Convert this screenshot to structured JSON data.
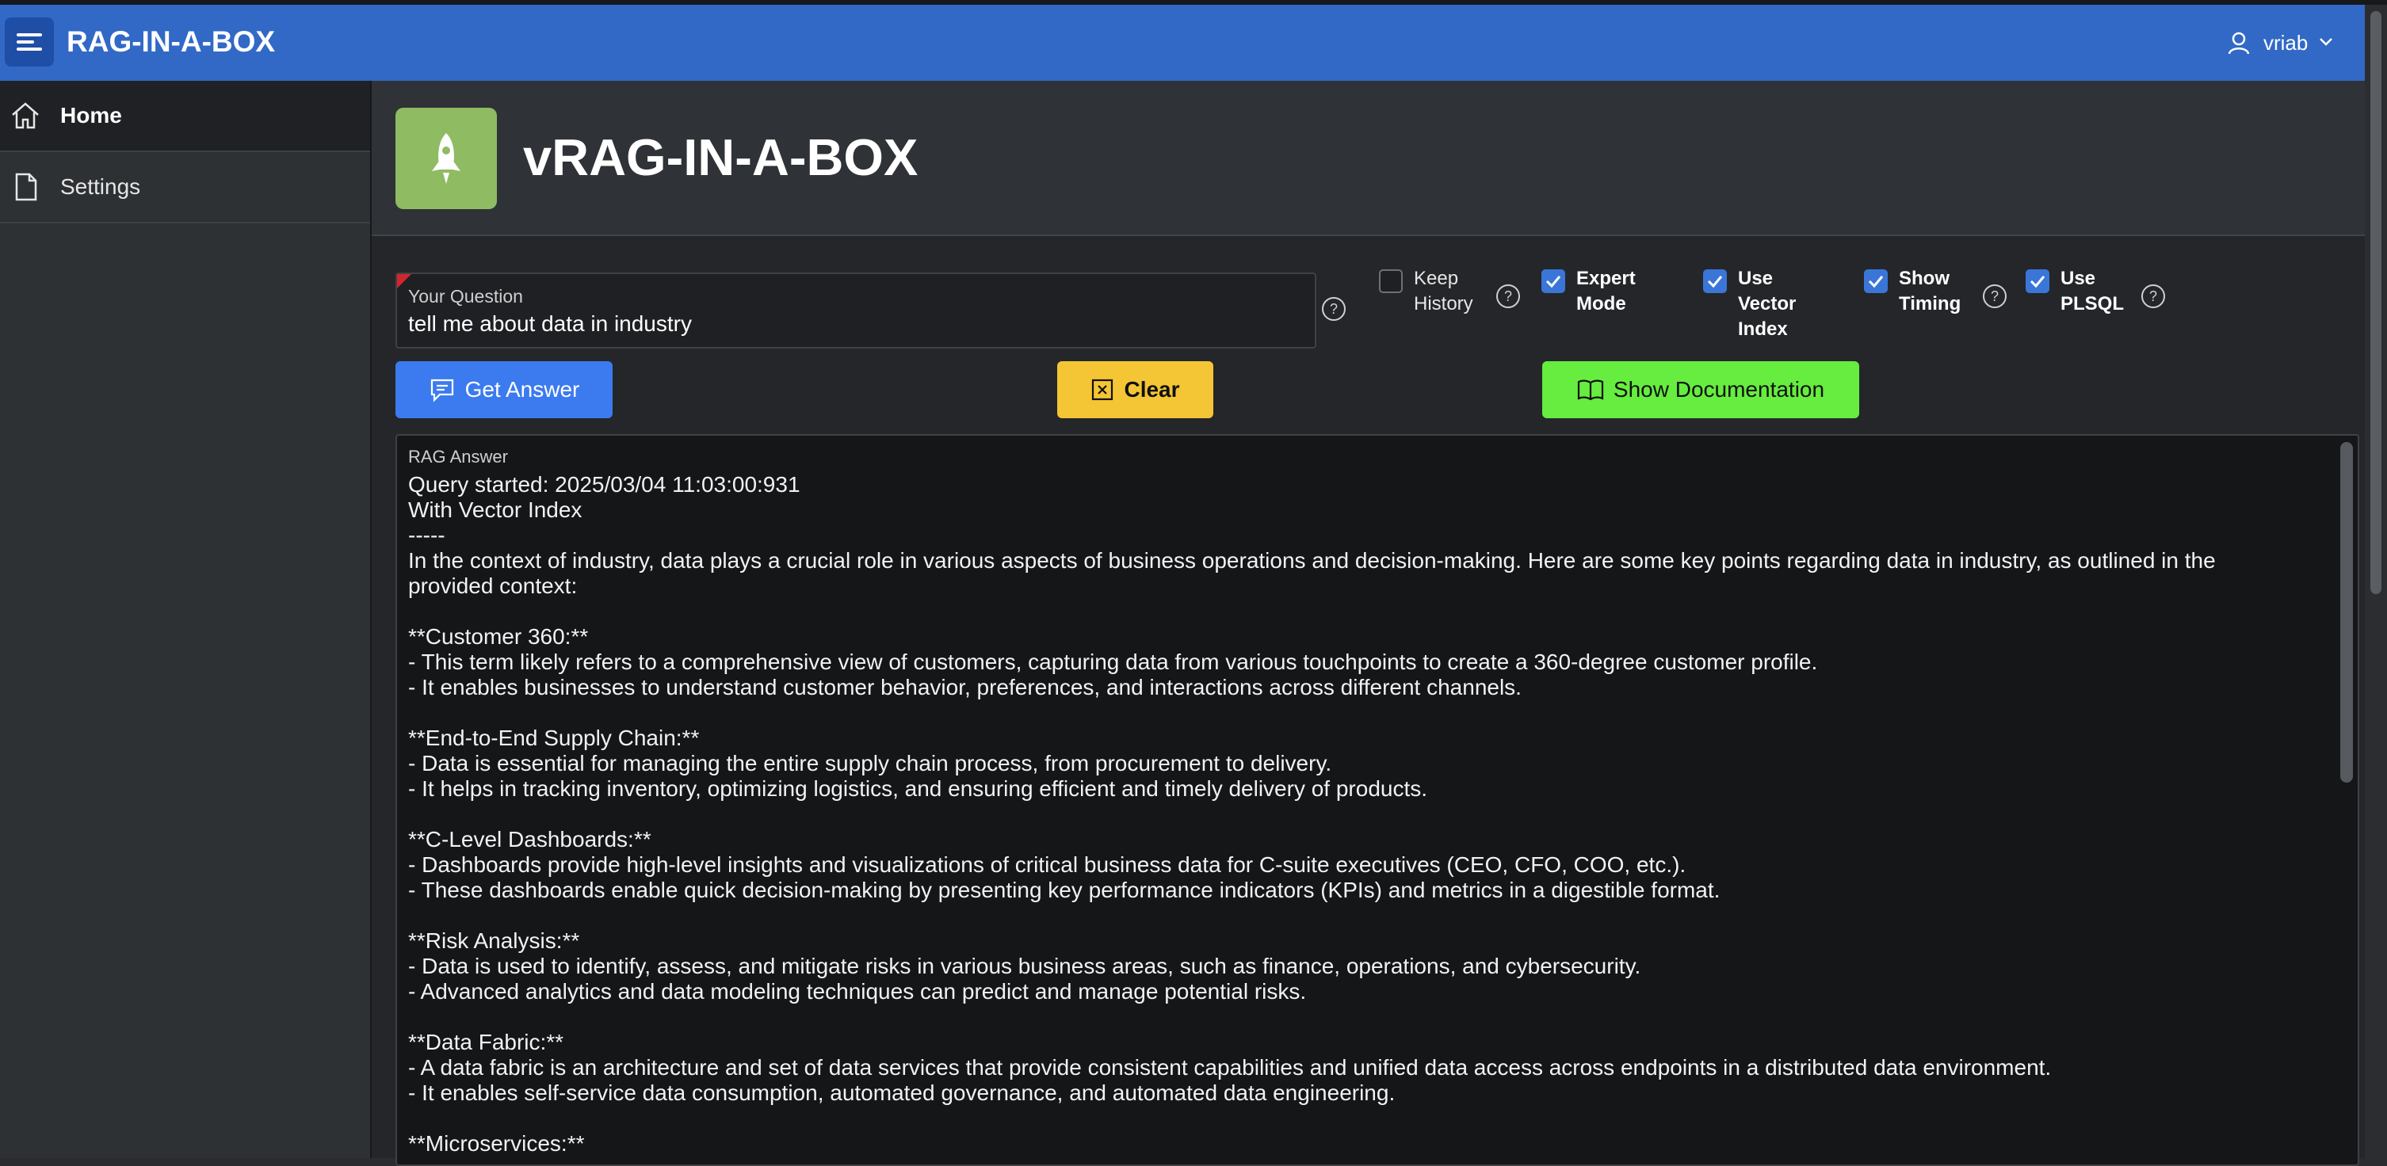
{
  "app": {
    "title": "RAG-IN-A-BOX"
  },
  "user": {
    "name": "vriab"
  },
  "sidebar": {
    "items": [
      {
        "label": "Home",
        "icon": "home-icon",
        "active": true
      },
      {
        "label": "Settings",
        "icon": "document-icon",
        "active": false
      }
    ]
  },
  "hero": {
    "title": "vRAG-IN-A-BOX",
    "icon": "rocket-icon",
    "icon_color": "#8fbb63"
  },
  "question": {
    "label": "Your Question",
    "value": "tell me about data in industry"
  },
  "options": {
    "keep_history": {
      "label": "Keep\nHistory",
      "checked": false
    },
    "expert_mode": {
      "label": "Expert\nMode",
      "checked": true
    },
    "use_vector_index": {
      "label": "Use\nVector\nIndex",
      "checked": true
    },
    "show_timing": {
      "label": "Show\nTiming",
      "checked": true
    },
    "use_plsql": {
      "label": "Use\nPLSQL",
      "checked": true
    }
  },
  "buttons": {
    "get_answer": {
      "label": "Get Answer",
      "color": "#3b7bef"
    },
    "clear": {
      "label": "Clear",
      "color": "#f4c534"
    },
    "show_docs": {
      "label": "Show Documentation",
      "color": "#66ed3f"
    }
  },
  "answer": {
    "label": "RAG Answer",
    "text": "Query started: 2025/03/04 11:03:00:931\nWith Vector Index\n-----\nIn the context of industry, data plays a crucial role in various aspects of business operations and decision-making. Here are some key points regarding data in industry, as outlined in the\nprovided context:\n\n**Customer 360:**\n- This term likely refers to a comprehensive view of customers, capturing data from various touchpoints to create a 360-degree customer profile.\n- It enables businesses to understand customer behavior, preferences, and interactions across different channels.\n\n**End-to-End Supply Chain:**\n- Data is essential for managing the entire supply chain process, from procurement to delivery.\n- It helps in tracking inventory, optimizing logistics, and ensuring efficient and timely delivery of products.\n\n**C-Level Dashboards:**\n- Dashboards provide high-level insights and visualizations of critical business data for C-suite executives (CEO, CFO, COO, etc.).\n- These dashboards enable quick decision-making by presenting key performance indicators (KPIs) and metrics in a digestible format.\n\n**Risk Analysis:**\n- Data is used to identify, assess, and mitigate risks in various business areas, such as finance, operations, and cybersecurity.\n- Advanced analytics and data modeling techniques can predict and manage potential risks.\n\n**Data Fabric:**\n- A data fabric is an architecture and set of data services that provide consistent capabilities and unified data access across endpoints in a distributed data environment.\n- It enables self-service data consumption, automated governance, and automated data engineering.\n\n**Microservices:**"
  },
  "colors": {
    "header": "#3269c6",
    "sidebar": "#2e3134",
    "accent": "#3a76d8"
  }
}
